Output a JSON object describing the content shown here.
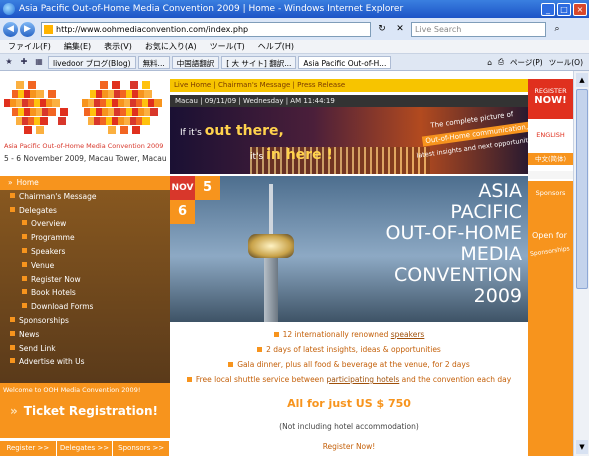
{
  "browser": {
    "window_title": "Asia Pacific Out-of-Home Media Convention 2009 | Home - Windows Internet Explorer",
    "url": "http://www.oohmediaconvention.com/index.php",
    "search_placeholder": "Live Search",
    "menu": [
      "ファイル(F)",
      "編集(E)",
      "表示(V)",
      "お気に入り(A)",
      "ツール(T)",
      "ヘルプ(H)"
    ],
    "tabs": [
      "livedoor ブログ(Blog)",
      "無料...",
      "中国語翻訳",
      "[ 大 サイト] 翻訳...",
      "Asia Pacific Out-of-H..."
    ],
    "toolbar_right": [
      "ページ(P)",
      "ツール(O)"
    ]
  },
  "site": {
    "logo_subtitle": "Asia Pacific Out-of-Home Media Convention 2009",
    "logo_date": "5 - 6 November 2009, Macau Tower, Macau",
    "topnav": "Live Home | Chairman's Message | Press Release",
    "datebar": "Macau | 09/11/09 | Wednesday | AM 11:44:19",
    "banner": {
      "line1_prefix": "If it's",
      "line1_bold": "out there,",
      "line2_prefix": "it's",
      "line2_bold": "in here !",
      "tag1": "The complete picture of",
      "tag2": "Out-of-Home communication,",
      "tag3": "latest insights and next opportunities!"
    },
    "nav": [
      {
        "label": "Home",
        "sub": false,
        "home": true
      },
      {
        "label": "Chairman's Message",
        "sub": false
      },
      {
        "label": "Delegates",
        "sub": false
      },
      {
        "label": "Overview",
        "sub": true
      },
      {
        "label": "Programme",
        "sub": true
      },
      {
        "label": "Speakers",
        "sub": true
      },
      {
        "label": "Venue",
        "sub": true
      },
      {
        "label": "Register Now",
        "sub": true
      },
      {
        "label": "Book Hotels",
        "sub": true
      },
      {
        "label": "Download Forms",
        "sub": true
      },
      {
        "label": "Sponsorships",
        "sub": false
      },
      {
        "label": "News",
        "sub": false
      },
      {
        "label": "Send Link",
        "sub": false
      },
      {
        "label": "Advertise with Us",
        "sub": false
      }
    ],
    "welcome": "Welcome to OOH Media Convention 2009!",
    "ticket_arrows": "»",
    "ticket": "Ticket Registration!",
    "bottom_links": [
      "Register  >>",
      "Delegates  >>",
      "Sponsors  >>"
    ],
    "hero": {
      "month": "NOV",
      "day1": "5",
      "day2": "6",
      "title_lines": [
        "ASIA",
        "PACIFIC",
        "OUT-OF-HOME",
        "MEDIA",
        "CONVENTION",
        "2009"
      ]
    },
    "info": {
      "line1_pre": "12 internationally renowned",
      "line1_link": "speakers",
      "line2": "2 days of latest insights, ideas & opportunities",
      "line3": "Gala dinner, plus all food & beverage at the venue, for 2 days",
      "line4_pre": "Free local shuttle service between",
      "line4_link": "participating hotels",
      "line4_post": "and the convention each day",
      "price": "All for just US $ 750",
      "excl": "(Not including hotel accommodation)",
      "register": "Register Now!"
    },
    "right": {
      "register_a": "REGISTER",
      "register_b": "NOW!",
      "english": "ENGLISH",
      "chinese": "中文(简体)",
      "sponsor": "Sponsors",
      "open_for": "Open for",
      "sponsorships": "Sponsorships"
    }
  },
  "colors": {
    "orange": "#f7941d",
    "red": "#d8372b",
    "brown": "#6b4420"
  }
}
